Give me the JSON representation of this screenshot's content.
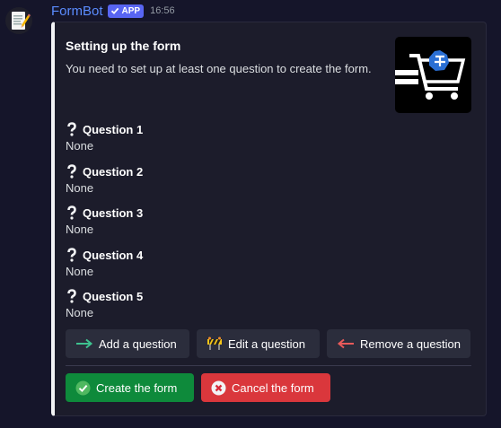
{
  "author": {
    "name": "FormBot",
    "badge": "APP",
    "timestamp": "16:56",
    "avatar_icon": "memo-icon"
  },
  "embed": {
    "title": "Setting up the form",
    "description": "You need to set up at least one question to create the form.",
    "accent_color": "#f2f3f5",
    "thumbnail_icon": "shopping-cart-logo",
    "fields": [
      {
        "name": "Question 1",
        "value": "None"
      },
      {
        "name": "Question 2",
        "value": "None"
      },
      {
        "name": "Question 3",
        "value": "None"
      },
      {
        "name": "Question 4",
        "value": "None"
      },
      {
        "name": "Question 5",
        "value": "None"
      }
    ]
  },
  "buttons": {
    "add_question": {
      "label": "Add a question",
      "icon": "arrow-right-icon"
    },
    "edit_question": {
      "label": "Edit a question",
      "icon": "construction-icon"
    },
    "remove_question": {
      "label": "Remove a question",
      "icon": "arrow-left-icon"
    },
    "create_form": {
      "label": "Create the form",
      "icon": "check-circle-icon",
      "color": "#0e8a3b"
    },
    "cancel_form": {
      "label": "Cancel the form",
      "icon": "x-icon",
      "color": "#da373c"
    }
  }
}
